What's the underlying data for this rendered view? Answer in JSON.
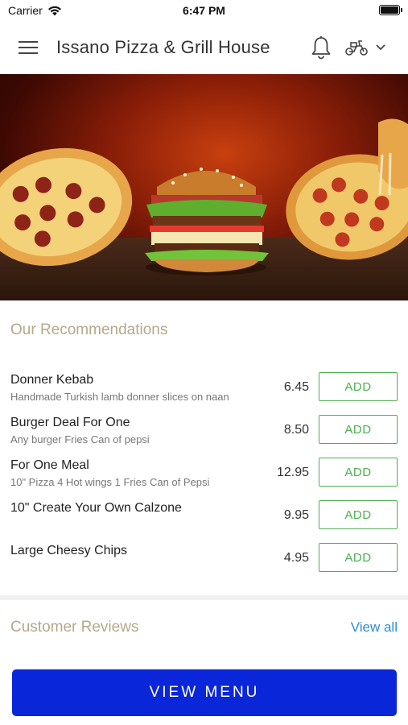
{
  "status_bar": {
    "carrier": "Carrier",
    "time": "6:47 PM"
  },
  "header": {
    "title": "Issano Pizza & Grill House",
    "menu_icon": "hamburger-menu-icon",
    "bell_icon": "bell-icon",
    "mode_icon": "scooter-icon",
    "dropdown_icon": "chevron-down-icon"
  },
  "hero": {
    "image": "food-banner"
  },
  "recommendations": {
    "title": "Our Recommendations",
    "items": [
      {
        "name": "Donner Kebab",
        "description": "Handmade Turkish lamb donner slices on naan",
        "price": "6.45",
        "button": "ADD"
      },
      {
        "name": "Burger Deal For One",
        "description": "Any burger Fries Can of pepsi",
        "price": "8.50",
        "button": "ADD"
      },
      {
        "name": "For One Meal",
        "description": "10\" Pizza 4 Hot wings 1 Fries Can of Pepsi",
        "price": "12.95",
        "button": "ADD"
      },
      {
        "name": "10\" Create Your Own Calzone",
        "description": "",
        "price": "9.95",
        "button": "ADD"
      },
      {
        "name": "Large Cheesy Chips",
        "description": "",
        "price": "4.95",
        "button": "ADD"
      }
    ]
  },
  "reviews": {
    "title": "Customer Reviews",
    "view_all": "View all"
  },
  "footer": {
    "view_menu": "VIEW MENU"
  },
  "colors": {
    "accent_green": "#4caf50",
    "primary_blue": "#0a26d9",
    "link_blue": "#2a8fd4",
    "section_title": "#b5a98a"
  }
}
